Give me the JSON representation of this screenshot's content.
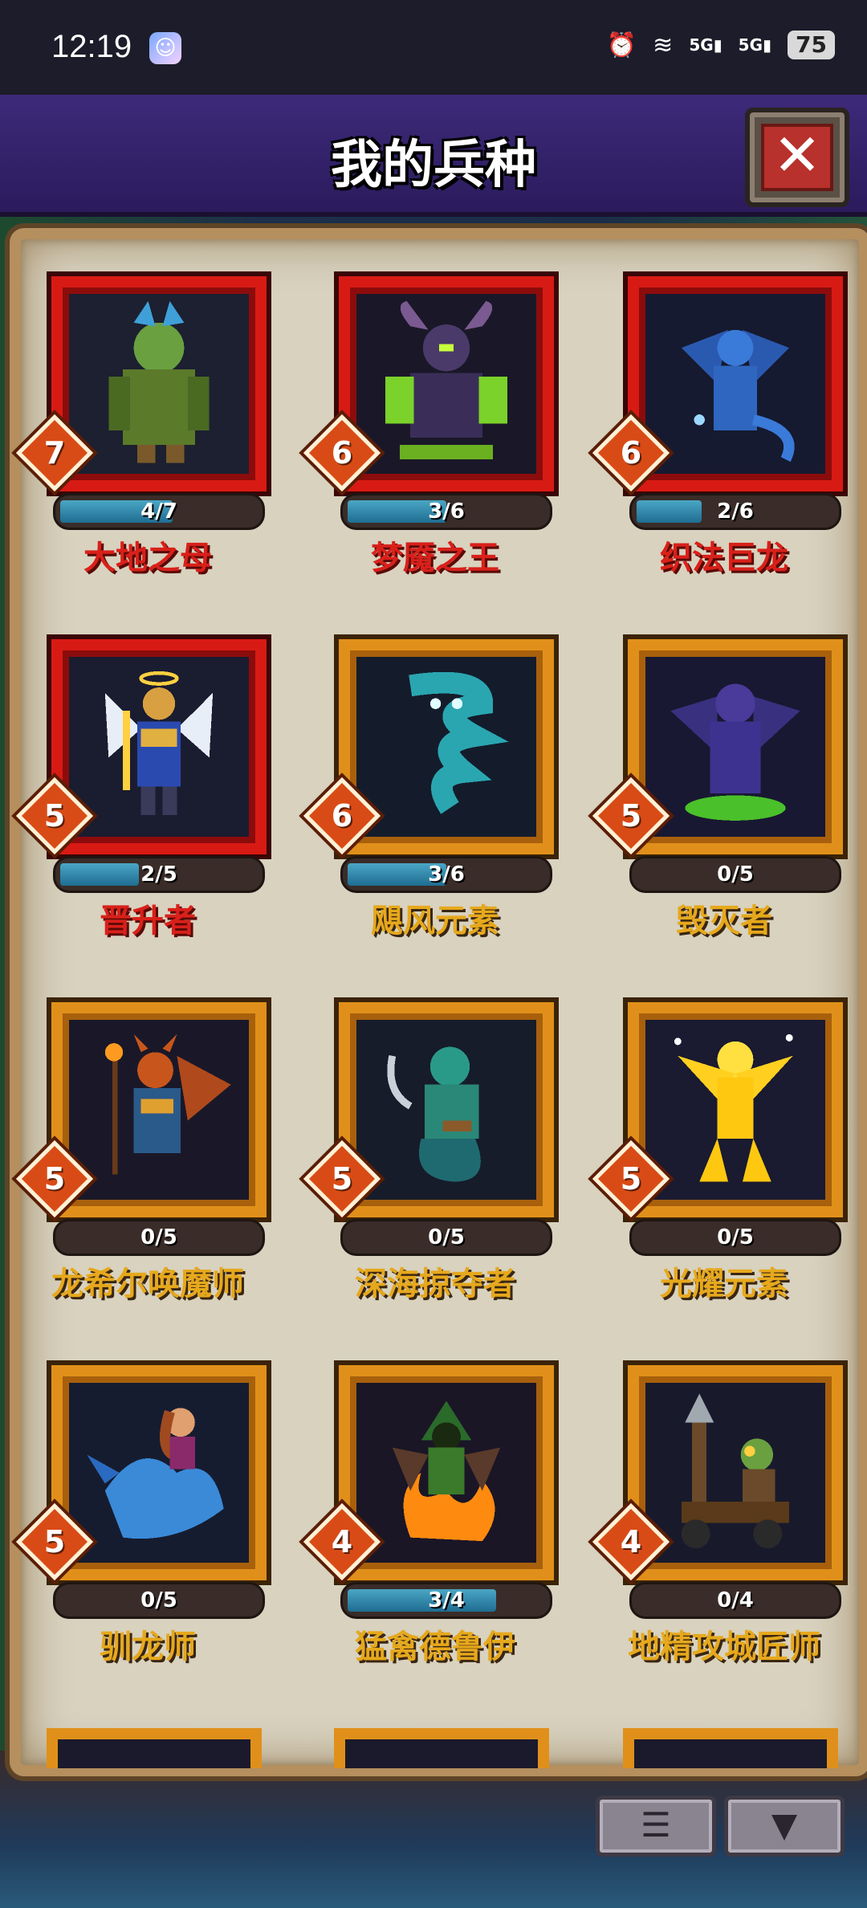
{
  "status_bar": {
    "time": "12:19",
    "network_1": "5G",
    "network_2": "5G",
    "battery": "75"
  },
  "header": {
    "title": "我的兵种",
    "close_glyph": "✕"
  },
  "units": [
    {
      "name": "大地之母",
      "tier": "7",
      "progress": "4/7",
      "fill": 0.57,
      "rarity": "red",
      "portrait": "earth-mother"
    },
    {
      "name": "梦魇之王",
      "tier": "6",
      "progress": "3/6",
      "fill": 0.5,
      "rarity": "red",
      "portrait": "nightmare-king"
    },
    {
      "name": "织法巨龙",
      "tier": "6",
      "progress": "2/6",
      "fill": 0.33,
      "rarity": "red",
      "portrait": "arcane-dragon"
    },
    {
      "name": "晋升者",
      "tier": "5",
      "progress": "2/5",
      "fill": 0.4,
      "rarity": "red",
      "portrait": "ascendant"
    },
    {
      "name": "飓风元素",
      "tier": "6",
      "progress": "3/6",
      "fill": 0.5,
      "rarity": "gold",
      "portrait": "storm-elemental"
    },
    {
      "name": "毁灭者",
      "tier": "5",
      "progress": "0/5",
      "fill": 0,
      "rarity": "gold",
      "portrait": "destroyer"
    },
    {
      "name": "龙希尔唤魔师",
      "tier": "5",
      "progress": "0/5",
      "fill": 0,
      "rarity": "gold",
      "portrait": "demon-caller"
    },
    {
      "name": "深海掠夺者",
      "tier": "5",
      "progress": "0/5",
      "fill": 0,
      "rarity": "gold",
      "portrait": "deep-raider"
    },
    {
      "name": "光耀元素",
      "tier": "5",
      "progress": "0/5",
      "fill": 0,
      "rarity": "gold",
      "portrait": "light-elemental"
    },
    {
      "name": "驯龙师",
      "tier": "5",
      "progress": "0/5",
      "fill": 0,
      "rarity": "gold",
      "portrait": "dragon-tamer"
    },
    {
      "name": "猛禽德鲁伊",
      "tier": "4",
      "progress": "3/4",
      "fill": 0.75,
      "rarity": "gold",
      "portrait": "raptor-druid"
    },
    {
      "name": "地精攻城匠师",
      "tier": "4",
      "progress": "0/4",
      "fill": 0,
      "rarity": "gold",
      "portrait": "goblin-siege"
    }
  ],
  "footer": {
    "list_icon": "list-icon",
    "filter_icon": "filter-icon"
  }
}
